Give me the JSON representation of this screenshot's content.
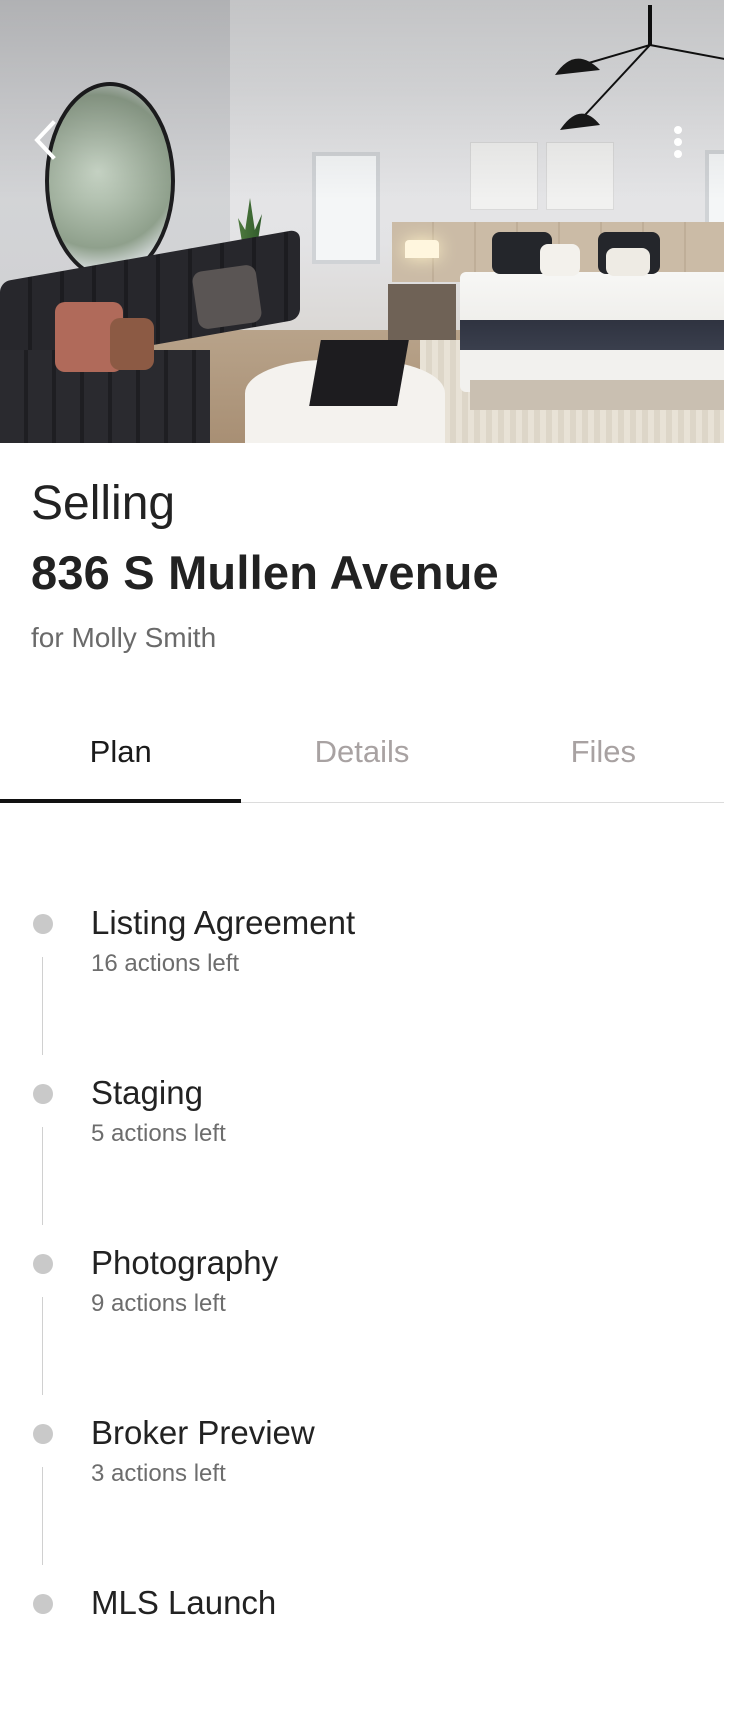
{
  "hero": {
    "back_icon": "chevron-left-icon",
    "more_icon": "more-vertical-icon"
  },
  "header": {
    "eyebrow": "Selling",
    "address": "836 S Mullen Avenue",
    "client": "for Molly Smith"
  },
  "tabs": [
    {
      "label": "Plan",
      "active": true
    },
    {
      "label": "Details",
      "active": false
    },
    {
      "label": "Files",
      "active": false
    }
  ],
  "steps": [
    {
      "title": "Listing Agreement",
      "subtitle": "16 actions left"
    },
    {
      "title": "Staging",
      "subtitle": "5 actions left"
    },
    {
      "title": "Photography",
      "subtitle": "9 actions left"
    },
    {
      "title": "Broker Preview",
      "subtitle": "3 actions left"
    },
    {
      "title": "MLS Launch",
      "subtitle": ""
    }
  ],
  "colors": {
    "accent": "#111111",
    "inactive_tab": "#a8a2a2",
    "dot": "#c9c9c9"
  }
}
